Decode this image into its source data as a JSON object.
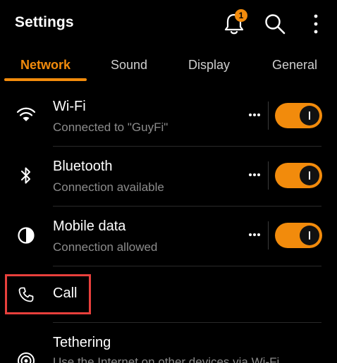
{
  "header": {
    "title": "Settings",
    "notification_count": "1"
  },
  "tabs": [
    {
      "label": "Network",
      "active": true
    },
    {
      "label": "Sound",
      "active": false
    },
    {
      "label": "Display",
      "active": false
    },
    {
      "label": "General",
      "active": false
    }
  ],
  "items": [
    {
      "title": "Wi-Fi",
      "subtitle": "Connected to \"GuyFi\"",
      "icon": "wifi-icon",
      "toggle_on": true
    },
    {
      "title": "Bluetooth",
      "subtitle": "Connection available",
      "icon": "bluetooth-icon",
      "toggle_on": true
    },
    {
      "title": "Mobile data",
      "subtitle": "Connection allowed",
      "icon": "mobile-data-icon",
      "toggle_on": true
    },
    {
      "title": "Call",
      "icon": "phone-icon"
    },
    {
      "title": "Tethering",
      "subtitle": "Use the Internet on other devices via Wi-Fi",
      "icon": "tethering-icon"
    }
  ],
  "colors": {
    "accent": "#f28b0c",
    "background": "#000000",
    "highlight": "#e8403c",
    "subtitle": "#8c8c8c"
  }
}
